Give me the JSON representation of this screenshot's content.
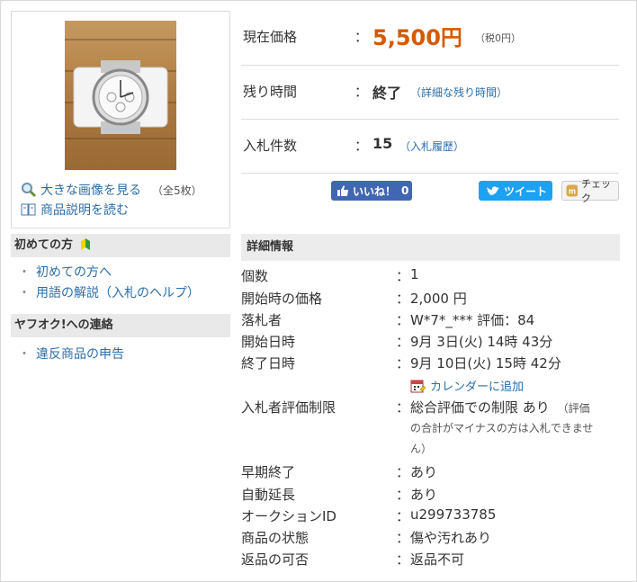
{
  "gallery": {
    "enlarge_label": "大きな画像を見る",
    "count_label": "（全5枚）",
    "description_label": "商品説明を読む"
  },
  "sidebar": {
    "beginners_title": "初めての方",
    "beginners_items": [
      "初めての方へ",
      "用語の解説（入札のヘルプ）"
    ],
    "contact_title": "ヤフオク!への連絡",
    "contact_items": [
      "違反商品の申告"
    ]
  },
  "summary": {
    "price_label": "現在価格",
    "price_value": "5,500円",
    "tax_note": "（税0円）",
    "time_label": "残り時間",
    "time_value": "終了",
    "time_link": "（詳細な残り時間）",
    "bids_label": "入札件数",
    "bids_value": "15",
    "bids_link": "（入札履歴）",
    "colon": "："
  },
  "social": {
    "like_label": "いいね！",
    "like_count": "0",
    "tweet_label": "ツイート",
    "check_label": "チェック"
  },
  "details": {
    "title": "詳細情報",
    "calendar_label": "カレンダーに追加",
    "rows": [
      {
        "label": "個数",
        "value": "1"
      },
      {
        "label": "開始時の価格",
        "value": "2,000 円"
      },
      {
        "label": "落札者",
        "value": "W*7*_*** 評価：84"
      },
      {
        "label": "開始日時",
        "value": "9月 3日(火) 14時 43分"
      },
      {
        "label": "終了日時",
        "value": "9月 10日(火) 15時 42分"
      },
      {
        "label": "入札者評価制限",
        "value": "総合評価での制限 あり",
        "note_1": "（評価",
        "note_2": "の合計がマイナスの方は入札できませ",
        "note_3": "ん）"
      },
      {
        "label": "早期終了",
        "value": "あり"
      },
      {
        "label": "自動延長",
        "value": "あり"
      },
      {
        "label": "オークションID",
        "value": "u299733785"
      },
      {
        "label": "商品の状態",
        "value": "傷や汚れあり"
      },
      {
        "label": "返品の可否",
        "value": "返品不可"
      }
    ]
  },
  "colors": {
    "price": "#d45a00",
    "link": "#2b6ea8",
    "facebook": "#4267b2",
    "twitter": "#1da1f2"
  }
}
